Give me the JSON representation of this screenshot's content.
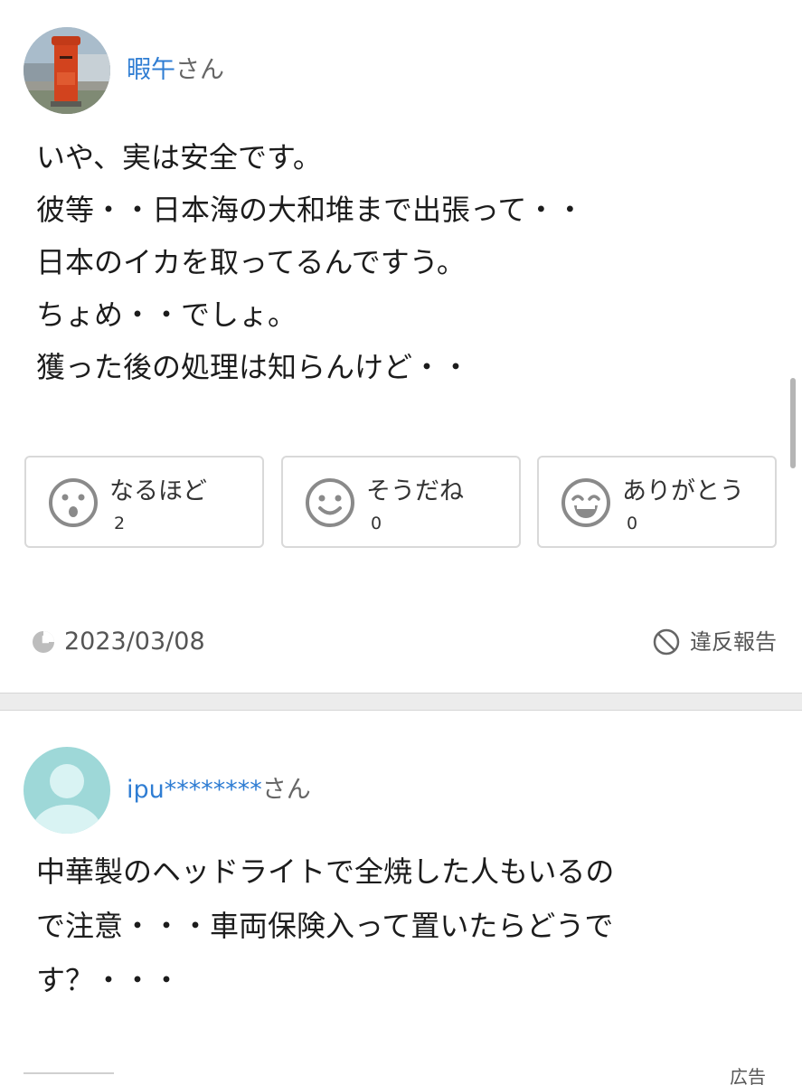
{
  "comments": [
    {
      "username": "暇午",
      "suffix": "さん",
      "avatar": "postbox-photo",
      "body_lines": [
        "いや、実は安全です。",
        "彼等・・日本海の大和堆まで出張って・・",
        "日本のイカを取ってるんですう。",
        "ちょめ・・でしょ。",
        "獲った後の処理は知らんけど・・"
      ],
      "reactions": [
        {
          "label": "なるほど",
          "count": "2",
          "icon": "surprised-face-icon"
        },
        {
          "label": "そうだね",
          "count": "0",
          "icon": "smile-face-icon"
        },
        {
          "label": "ありがとう",
          "count": "0",
          "icon": "grin-face-icon"
        }
      ],
      "date": "2023/03/08",
      "report_label": "違反報告"
    },
    {
      "username": "ipu********",
      "suffix": "さん",
      "avatar": "default-user-avatar",
      "body_lines": [
        "中華製のヘッドライトで全焼した人もいるの",
        "で注意・・・車両保険入って置いたらどうで",
        "す？・・・"
      ]
    }
  ],
  "ad_label": "広告",
  "colors": {
    "username": "#2f7dd3",
    "icon_gray": "#8a8a8a",
    "border": "#d9d9d9",
    "default_avatar": "#9ed8d8"
  }
}
